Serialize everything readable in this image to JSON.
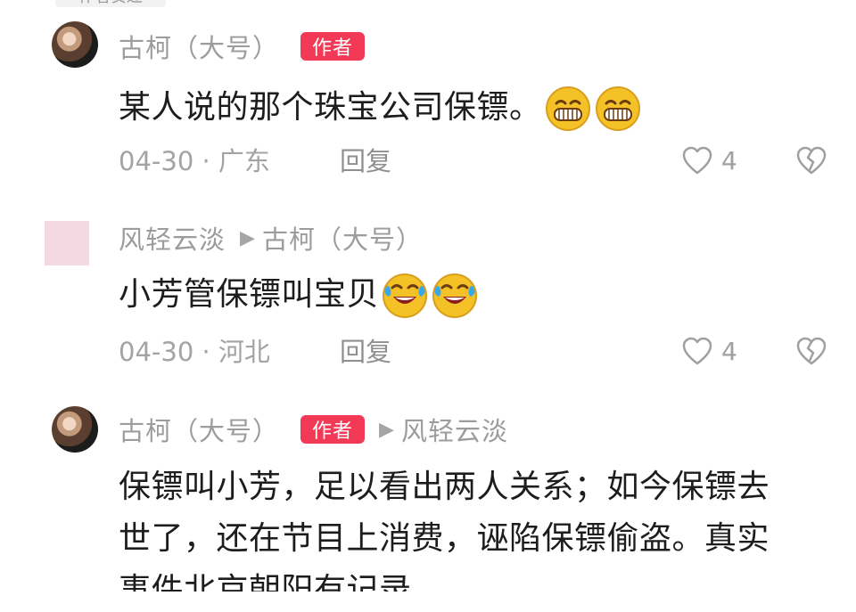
{
  "top_fragment": "作者赞过",
  "comments": [
    {
      "username": "古柯（大号）",
      "badge": "作者",
      "text": "某人说的那个珠宝公司保镖。",
      "emoji_icons": [
        "grinning-face-icon",
        "grinning-face-icon"
      ],
      "date_location": "04-30 · 广东",
      "reply_label": "回复",
      "like_count": "4"
    },
    {
      "username": "风轻云淡",
      "reply_to": "古柯（大号）",
      "text": "小芳管保镖叫宝贝",
      "emoji_icons": [
        "laughing-crying-face-icon",
        "laughing-crying-face-icon"
      ],
      "date_location": "04-30 · 河北",
      "reply_label": "回复",
      "like_count": "4"
    },
    {
      "username": "古柯（大号）",
      "badge": "作者",
      "reply_to": "风轻云淡",
      "text_lines": [
        "保镖叫小芳，足以看出两人关系；如今保镖去",
        "世了，还在节目上消费，诬陷保镖偷盗。真实",
        "事件北京朝阳有记录"
      ]
    }
  ],
  "icons": {
    "like": "heart-outline-icon",
    "dislike": "broken-heart-outline-icon",
    "reply_arrow": "play-triangle-icon"
  },
  "colors": {
    "author_badge": "#f23a57",
    "username": "#9c9c9c",
    "body_text": "#1d1d1d",
    "meta_text": "#a3a3a3"
  }
}
